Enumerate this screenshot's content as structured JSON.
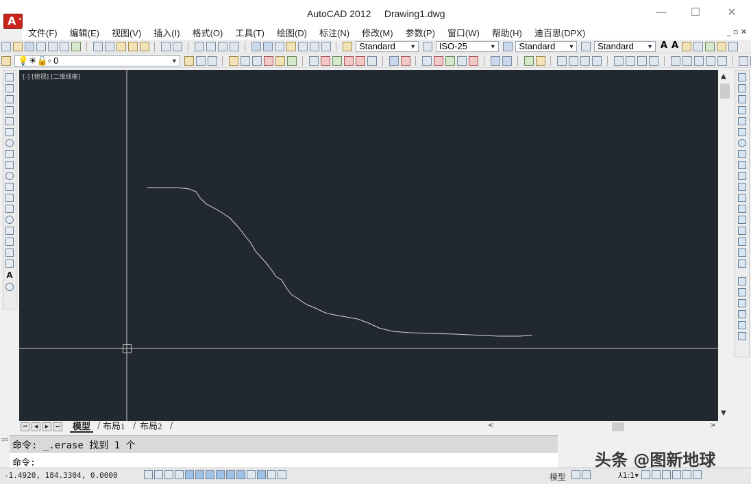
{
  "window": {
    "title": "AutoCAD 2012     Drawing1.dwg",
    "minimize_glyph": "—",
    "maximize_glyph": "☐",
    "close_glyph": "✕"
  },
  "app_logo": {
    "letter": "A",
    "caret": "▾",
    "color": "#c8241c"
  },
  "menu": {
    "items": [
      "文件(F)",
      "编辑(E)",
      "视图(V)",
      "插入(I)",
      "格式(O)",
      "工具(T)",
      "绘图(D)",
      "标注(N)",
      "修改(M)",
      "参数(P)",
      "窗口(W)",
      "帮助(H)",
      "迪百思(DPX)"
    ],
    "right_controls": "_ ▫ ✕"
  },
  "toolbar1": {
    "text_style": "Standard",
    "dim_style": "ISO-25",
    "table_style": "Standard",
    "multileader_style": "Standard",
    "text_glyphs": [
      "A",
      "A"
    ]
  },
  "toolbar2": {
    "layer_value": "0"
  },
  "canvas": {
    "view_label": "[-] [俯视] [二维线框]",
    "background": "#212830",
    "line_color": "#d8d8d8"
  },
  "tabs": {
    "nav": [
      "⏮",
      "◀",
      "▶",
      "⏭"
    ],
    "model": "模型",
    "layout1": "布局1",
    "layout2": "布局2"
  },
  "scroll": {
    "up": "▲",
    "down": "▼",
    "left": "<",
    "right": ">"
  },
  "command": {
    "history": "命令: _.erase 找到 1 个",
    "prompt": "命令:"
  },
  "status": {
    "coords": "-1.4920, 184.3304, 0.0000",
    "model_label": "模型",
    "annotation_scale": "⅄1:1▾"
  },
  "watermark": "头条 @图新地球"
}
